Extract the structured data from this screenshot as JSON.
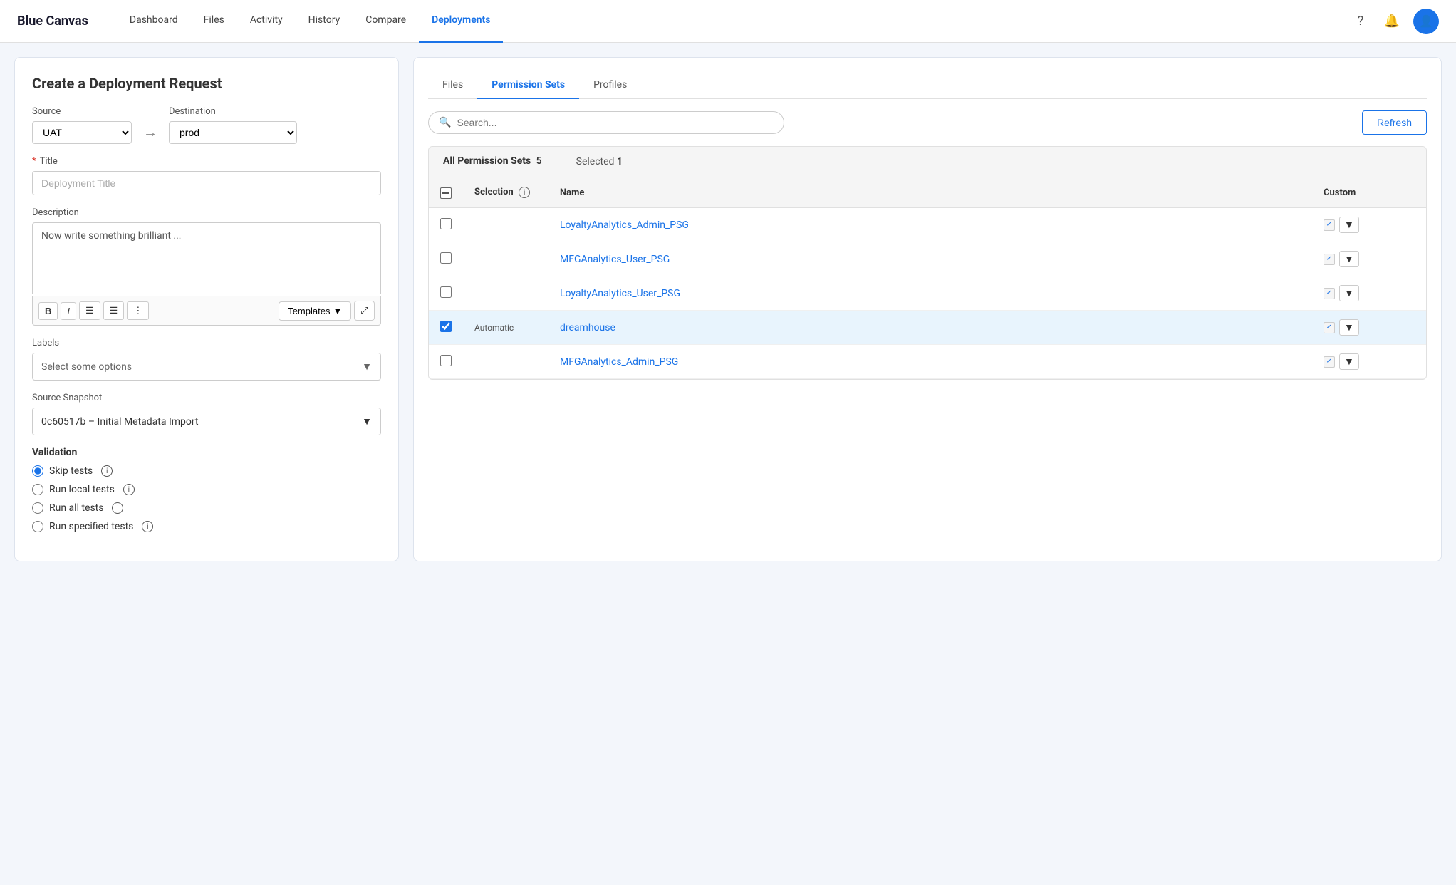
{
  "app": {
    "brand": "Blue Canvas",
    "nav_links": [
      {
        "label": "Dashboard",
        "active": false
      },
      {
        "label": "Files",
        "active": false
      },
      {
        "label": "Activity",
        "active": false
      },
      {
        "label": "History",
        "active": false
      },
      {
        "label": "Compare",
        "active": false
      },
      {
        "label": "Deployments",
        "active": true
      }
    ]
  },
  "left_panel": {
    "title": "Create a Deployment Request",
    "source_label": "Source",
    "source_value": "UAT",
    "destination_label": "Destination",
    "destination_value": "prod",
    "title_label": "Title",
    "title_placeholder": "Deployment Title",
    "description_label": "Description",
    "description_placeholder": "Now write something brilliant ...",
    "toolbar": {
      "bold": "B",
      "italic": "I",
      "ol": "≡",
      "ul": "☰",
      "more": "⋮",
      "templates_label": "Templates",
      "expand_label": "⤢"
    },
    "labels_label": "Labels",
    "labels_placeholder": "Select some options",
    "source_snapshot_label": "Source Snapshot",
    "source_snapshot_value": "0c60517b – Initial Metadata Import",
    "validation": {
      "title": "Validation",
      "options": [
        {
          "label": "Skip tests",
          "value": "skip",
          "checked": true
        },
        {
          "label": "Run local tests",
          "value": "local",
          "checked": false
        },
        {
          "label": "Run all tests",
          "value": "all",
          "checked": false
        },
        {
          "label": "Run specified tests",
          "value": "specified",
          "checked": false
        }
      ]
    }
  },
  "right_panel": {
    "tabs": [
      {
        "label": "Files",
        "active": false
      },
      {
        "label": "Permission Sets",
        "active": true
      },
      {
        "label": "Profiles",
        "active": false
      }
    ],
    "search_placeholder": "Search...",
    "refresh_label": "Refresh",
    "all_count": 5,
    "selected_count": 1,
    "table_headers": {
      "selection": "Selection",
      "name": "Name",
      "custom": "Custom"
    },
    "rows": [
      {
        "id": 1,
        "selection": "",
        "automatic": false,
        "name": "LoyaltyAnalytics_Admin_PSG",
        "custom": true,
        "selected": false
      },
      {
        "id": 2,
        "selection": "",
        "automatic": false,
        "name": "MFGAnalytics_User_PSG",
        "custom": true,
        "selected": false
      },
      {
        "id": 3,
        "selection": "",
        "automatic": false,
        "name": "LoyaltyAnalytics_User_PSG",
        "custom": true,
        "selected": false
      },
      {
        "id": 4,
        "selection": "Automatic",
        "automatic": true,
        "name": "dreamhouse",
        "custom": true,
        "selected": true
      },
      {
        "id": 5,
        "selection": "",
        "automatic": false,
        "name": "MFGAnalytics_Admin_PSG",
        "custom": true,
        "selected": false
      }
    ]
  }
}
